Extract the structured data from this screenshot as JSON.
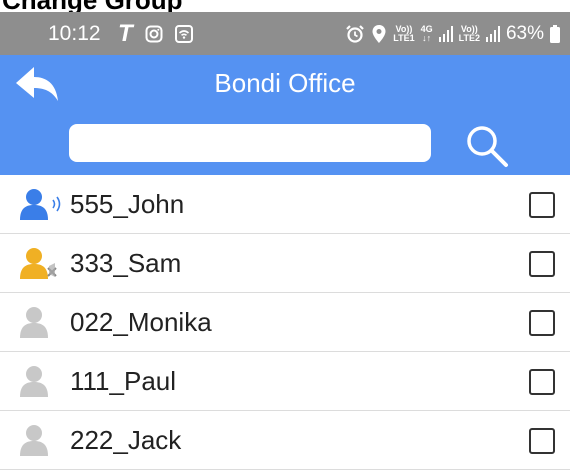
{
  "caption": "Change Group",
  "status_bar": {
    "time": "10:12",
    "volte1_top": "Vo))",
    "volte1_bottom": "LTE1",
    "net_top": "4G",
    "net_bottom": "↓↑",
    "volte2_top": "Vo))",
    "volte2_bottom": "LTE2",
    "battery": "63%",
    "left_icons": [
      "tiktok-icon",
      "instagram-icon",
      "wifi-icon"
    ],
    "right_icons": [
      "alarm-icon",
      "location-icon",
      "signal-icon",
      "battery-icon"
    ]
  },
  "header": {
    "title": "Bondi Office",
    "search": {
      "value": "",
      "placeholder": ""
    }
  },
  "contacts": [
    {
      "name": "555_John",
      "status": "speaking",
      "checked": false
    },
    {
      "name": "333_Sam",
      "status": "muted",
      "checked": false
    },
    {
      "name": "022_Monika",
      "status": "offline",
      "checked": false
    },
    {
      "name": "111_Paul",
      "status": "offline",
      "checked": false
    },
    {
      "name": "222_Jack",
      "status": "offline",
      "checked": false
    }
  ],
  "colors": {
    "header": "#5592f2",
    "status_bar": "#8e8e8e",
    "speaking": "#3a7ee8",
    "muted": "#f0b024",
    "offline": "#c8c8c8"
  }
}
